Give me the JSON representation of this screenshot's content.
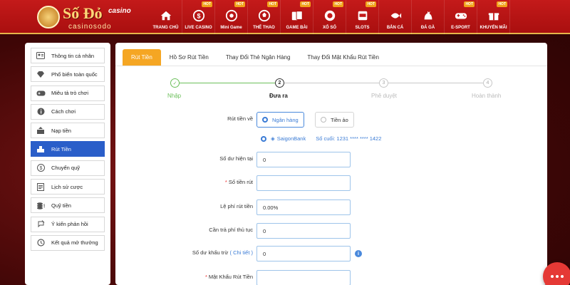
{
  "brand": {
    "name": "Số Đỏ",
    "tag": "casino",
    "sub": "casinosodo"
  },
  "nav": [
    {
      "label": "TRANG CHỦ",
      "icon": "home-icon",
      "hot": ""
    },
    {
      "label": "LIVE CASINO",
      "icon": "casino-chip-icon",
      "hot": "HOT"
    },
    {
      "label": "Mini Game",
      "icon": "roulette-icon",
      "hot": "HOT"
    },
    {
      "label": "THỂ THAO",
      "icon": "soccer-ball-icon",
      "hot": "HOT"
    },
    {
      "label": "GAME BÀI",
      "icon": "playing-cards-icon",
      "hot": "HOT"
    },
    {
      "label": "XỔ SỐ",
      "icon": "lottery-ball-icon",
      "hot": "HOT"
    },
    {
      "label": "SLOTS",
      "icon": "slot-machine-icon",
      "hot": "HOT"
    },
    {
      "label": "BẮN CÁ",
      "icon": "fish-icon",
      "hot": ""
    },
    {
      "label": "ĐÁ GÀ",
      "icon": "rooster-icon",
      "hot": ""
    },
    {
      "label": "E-SPORT",
      "icon": "gamepad-icon",
      "hot": "HOT"
    },
    {
      "label": "KHUYẾN MÃI",
      "icon": "gift-icon",
      "hot": "HOT"
    }
  ],
  "sidebar": {
    "items": [
      {
        "label": "Thông tin cá nhân",
        "icon": "id-card-icon",
        "active": false
      },
      {
        "label": "Phổ biến toàn quốc",
        "icon": "diamond-icon",
        "active": false
      },
      {
        "label": "Miêu tả trò chơi",
        "icon": "gamepad-icon",
        "active": false
      },
      {
        "label": "Cách chơi",
        "icon": "info-icon",
        "active": false
      },
      {
        "label": "Nạp tiền",
        "icon": "deposit-icon",
        "active": false
      },
      {
        "label": "Rút Tiền",
        "icon": "withdraw-icon",
        "active": true
      },
      {
        "label": "Chuyển quỹ",
        "icon": "dollar-circle-icon",
        "active": false
      },
      {
        "label": "Lịch sử cược",
        "icon": "document-list-icon",
        "active": false
      },
      {
        "label": "Quỹ tiền",
        "icon": "coins-icon",
        "active": false
      },
      {
        "label": "Ý kiến phản hồi",
        "icon": "feedback-icon",
        "active": false
      },
      {
        "label": "Kết quả mở thưởng",
        "icon": "history-icon",
        "active": false
      }
    ]
  },
  "tabs": [
    {
      "label": "Rút Tiền",
      "active": true
    },
    {
      "label": "Hồ Sơ Rút Tiền",
      "active": false
    },
    {
      "label": "Thay Đổi Thẻ Ngân Hàng",
      "active": false
    },
    {
      "label": "Thay Đổi Mật Khẩu Rút Tiền",
      "active": false
    }
  ],
  "steps": [
    {
      "number": "✓",
      "label": "Nhập",
      "state": "done"
    },
    {
      "number": "2",
      "label": "Đưa ra",
      "state": "current"
    },
    {
      "number": "3",
      "label": "Phê duyệt",
      "state": "pending"
    },
    {
      "number": "4",
      "label": "Hoàn thành",
      "state": "pending"
    }
  ],
  "form": {
    "withdraw_to_label": "Rút tiền về",
    "option_bank": "Ngân hàng",
    "option_virtual": "Tiền ảo",
    "bank_name": "SaigonBank",
    "bank_account": "Số cuối:  1231 **** **** 1422",
    "balance_label": "Số dư hiện tại",
    "balance_value": "0",
    "amount_label": "Số tiền rút",
    "amount_value": "",
    "fee_rate_label": "Lệ phí rút tiền",
    "fee_rate_value": "0.00%",
    "fee_label": "Cần trả phí thủ tục",
    "fee_value": "0",
    "deduct_label": "Số dư khấu trừ",
    "deduct_hint": "( Chi tiết )",
    "deduct_value": "0",
    "password_label": "Mật Khẩu Rút Tiền",
    "password_value": ""
  },
  "colors": {
    "primary_red": "#c41a1a",
    "accent_orange": "#f5a623",
    "active_blue": "#2a5ec9",
    "success_green": "#6bbf5a",
    "link_blue": "#3a7bd5"
  }
}
